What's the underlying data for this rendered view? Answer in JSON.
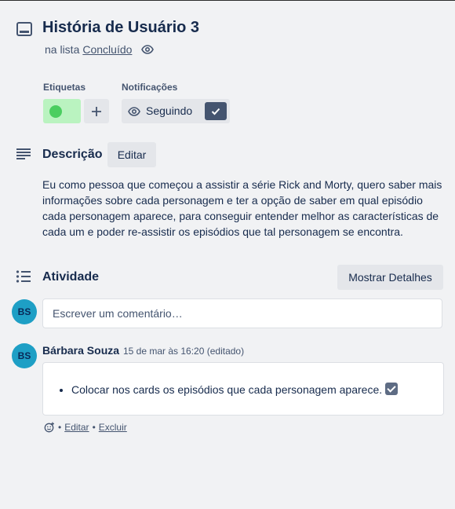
{
  "card": {
    "title": "História de Usuário 3",
    "list_prefix": "na lista",
    "list_name": "Concluído"
  },
  "labels_section": {
    "heading": "Etiquetas",
    "label_color": "#4bce60"
  },
  "notifications": {
    "heading": "Notificações",
    "button_label": "Seguindo"
  },
  "description": {
    "heading": "Descrição",
    "edit_label": "Editar",
    "text": "Eu como pessoa que começou a assistir a série Rick and Morty, quero saber mais informações sobre cada personagem e ter a opção de saber em qual episódio cada personagem aparece, para conseguir entender melhor as características de cada um e poder re-assistir os episódios que tal personagem se encontra."
  },
  "activity": {
    "heading": "Atividade",
    "show_details_label": "Mostrar Detalhes",
    "current_user_initials": "BS",
    "comment_placeholder": "Escrever um comentário…",
    "comments": [
      {
        "initials": "BS",
        "author": "Bárbara Souza",
        "timestamp": "15 de mar às 16:20 (editado)",
        "bullet": "Colocar nos cards os episódios que cada personagem aparece.",
        "edit_label": "Editar",
        "delete_label": "Excluir"
      }
    ]
  },
  "icons": [
    "card-icon",
    "eye-icon",
    "plus-icon",
    "check-icon",
    "description-icon",
    "activity-icon",
    "add-reaction-icon",
    "checkbox-emoji"
  ]
}
